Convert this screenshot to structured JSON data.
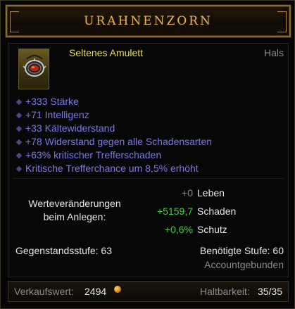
{
  "item": {
    "name": "URAHNENZORN",
    "type": "Seltenes Amulett",
    "slot": "Hals",
    "icon": "amulet-icon",
    "colors": {
      "name": "#e8b25a",
      "type": "#f0dc52",
      "affix": "#7a78e8",
      "positive": "#3fd23f",
      "neutral": "#8a8a8a"
    }
  },
  "affixes": [
    "+333 Stärke",
    "+71 Intelligenz",
    "+33 Kältewiderstand",
    "+78 Widerstand gegen alle Schadensarten",
    "+63% kritischer Trefferschaden",
    "Kritische Trefferchance um 8,5% erhöht"
  ],
  "compare": {
    "label": "Werteveränderungen beim Anlegen:",
    "stats": [
      {
        "value": "+0",
        "name": "Leben"
      },
      {
        "value": "+5159,7",
        "name": "Schaden"
      },
      {
        "value": "+0,6%",
        "name": "Schutz"
      }
    ]
  },
  "requirements": {
    "item_level": "Gegenstandsstufe: 63",
    "required_level": "Benötigte Stufe: 60",
    "binding": "Accountgebunden"
  },
  "footer": {
    "sell_label": "Verkaufswert:",
    "sell_value": "2494",
    "durability_label": "Haltbarkeit:",
    "durability_value": "35/35"
  }
}
